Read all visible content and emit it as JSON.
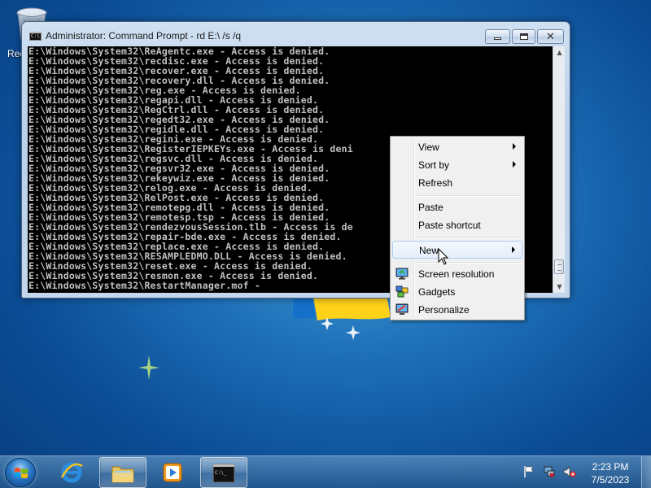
{
  "desktop": {
    "recycle_bin_label": "Rec"
  },
  "cmd_window": {
    "title": "Administrator: Command Prompt - rd  E:\\ /s /q",
    "lines": [
      "E:\\Windows\\System32\\ReAgentc.exe - Access is denied.",
      "E:\\Windows\\System32\\recdisc.exe - Access is denied.",
      "E:\\Windows\\System32\\recover.exe - Access is denied.",
      "E:\\Windows\\System32\\recovery.dll - Access is denied.",
      "E:\\Windows\\System32\\reg.exe - Access is denied.",
      "E:\\Windows\\System32\\regapi.dll - Access is denied.",
      "E:\\Windows\\System32\\RegCtrl.dll - Access is denied.",
      "E:\\Windows\\System32\\regedt32.exe - Access is denied.",
      "E:\\Windows\\System32\\regidle.dll - Access is denied.",
      "E:\\Windows\\System32\\regini.exe - Access is denied.",
      "E:\\Windows\\System32\\RegisterIEPKEYs.exe - Access is deni",
      "E:\\Windows\\System32\\regsvc.dll - Access is denied.",
      "E:\\Windows\\System32\\regsvr32.exe - Access is denied.",
      "E:\\Windows\\System32\\rekeywiz.exe - Access is denied.",
      "E:\\Windows\\System32\\relog.exe - Access is denied.",
      "E:\\Windows\\System32\\RelPost.exe - Access is denied.",
      "E:\\Windows\\System32\\remotepg.dll - Access is denied.",
      "E:\\Windows\\System32\\remotesp.tsp - Access is denied.",
      "E:\\Windows\\System32\\rendezvousSession.tlb - Access is de",
      "E:\\Windows\\System32\\repair-bde.exe - Access is denied.",
      "E:\\Windows\\System32\\replace.exe - Access is denied.",
      "E:\\Windows\\System32\\RESAMPLEDMO.DLL - Access is denied.",
      "E:\\Windows\\System32\\reset.exe - Access is denied.",
      "E:\\Windows\\System32\\resmon.exe - Access is denied.",
      "E:\\Windows\\System32\\RestartManager.mof -"
    ],
    "colors": {
      "console_bg": "#000000",
      "console_fg": "#c0c0c0"
    }
  },
  "context_menu": {
    "items": [
      {
        "label": "View",
        "submenu": true
      },
      {
        "label": "Sort by",
        "submenu": true
      },
      {
        "label": "Refresh",
        "submenu": false
      },
      {
        "label": "Paste",
        "submenu": false
      },
      {
        "label": "Paste shortcut",
        "submenu": false
      },
      {
        "label": "New",
        "submenu": true,
        "highlighted": true
      },
      {
        "label": "Screen resolution",
        "icon": "screen-resolution-icon"
      },
      {
        "label": "Gadgets",
        "icon": "gadgets-icon"
      },
      {
        "label": "Personalize",
        "icon": "personalize-icon"
      }
    ]
  },
  "taskbar": {
    "pinned": [
      {
        "name": "internet-explorer-icon",
        "active": false
      },
      {
        "name": "windows-explorer-icon",
        "active": true
      },
      {
        "name": "media-player-icon",
        "active": false
      },
      {
        "name": "command-prompt-icon",
        "active": true
      }
    ],
    "tray_icons": [
      "action-center-flag-icon",
      "network-icon",
      "volume-muted-icon"
    ],
    "clock": {
      "time": "2:23 PM",
      "date": "7/5/2023"
    }
  }
}
